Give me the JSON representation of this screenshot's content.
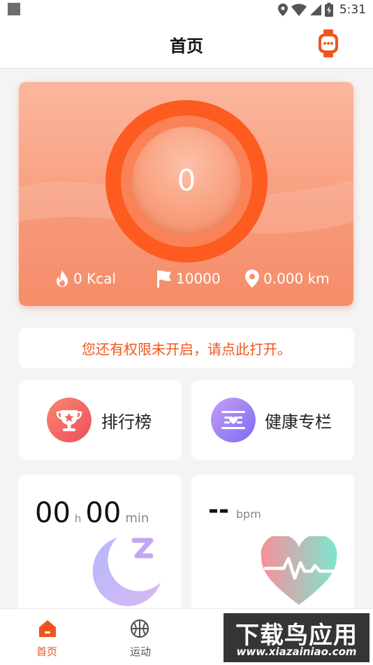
{
  "status_bar": {
    "time": "5:31"
  },
  "app_bar": {
    "title": "首页",
    "watch_icon": "smartwatch-icon"
  },
  "colors": {
    "accent": "#fd5b1f",
    "notice_text": "#f2541c",
    "tab_active": "#f2541c",
    "tab_inactive": "#555555"
  },
  "hero": {
    "ring_value": "0",
    "stats": [
      {
        "icon": "flame-icon",
        "value": "0 Kcal"
      },
      {
        "icon": "flag-icon",
        "value": "10000"
      },
      {
        "icon": "location-pin-icon",
        "value": "0.000 km"
      }
    ]
  },
  "notice": {
    "text": "您还有权限未开启，请点此打开。"
  },
  "features": [
    {
      "icon": "trophy-icon",
      "label": "排行榜"
    },
    {
      "icon": "health-column-icon",
      "label": "健康专栏"
    }
  ],
  "sleep_card": {
    "hours": "00",
    "hours_unit": "h",
    "minutes": "00",
    "minutes_unit": "min",
    "icon": "moon-sleep-icon"
  },
  "heart_card": {
    "value": "--",
    "unit": "bpm",
    "icon": "heart-pulse-icon"
  },
  "tabs": [
    {
      "label": "首页",
      "icon": "home-icon",
      "active": true
    },
    {
      "label": "运动",
      "icon": "basketball-icon",
      "active": false
    }
  ],
  "watermark": {
    "main": "下载鸟应用",
    "sub": "www.xiazainiao.com"
  }
}
